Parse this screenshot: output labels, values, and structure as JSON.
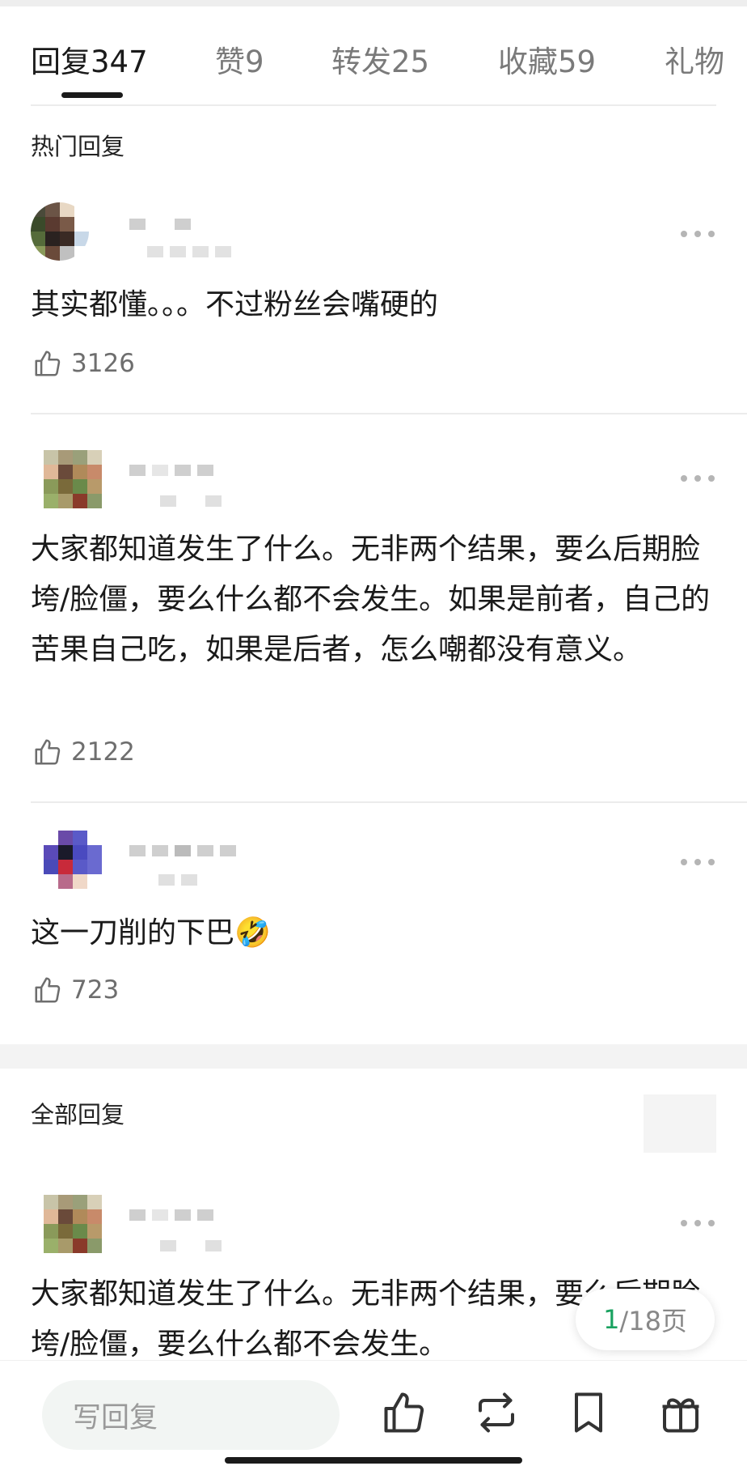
{
  "tabs": [
    {
      "label": "回复",
      "count": "347"
    },
    {
      "label": "赞",
      "count": "9"
    },
    {
      "label": "转发",
      "count": "25"
    },
    {
      "label": "收藏",
      "count": "59"
    },
    {
      "label": "礼物",
      "count": ""
    }
  ],
  "hot_section": {
    "title": "热门回复"
  },
  "all_section": {
    "title": "全部回复"
  },
  "comments": [
    {
      "text": "其实都懂。。。不过粉丝会嘴硬的",
      "likes": "3126"
    },
    {
      "text": "大家都知道发生了什么。无非两个结果，要么后期脸垮/脸僵，要么什么都不会发生。如果是前者，自己的苦果自己吃，如果是后者，怎么嘲都没有意义。",
      "likes": "2122"
    },
    {
      "text": "这一刀削的下巴",
      "emoji": "🤣",
      "likes": "723"
    },
    {
      "text": "大家都知道发生了什么。无非两个结果，要么后期脸垮/脸僵，要么什么都不会发生。"
    }
  ],
  "pager": {
    "current": "1",
    "total_label": "/18页"
  },
  "bottom_bar": {
    "reply_placeholder": "写回复"
  },
  "icons": {
    "like": "thumb-up-icon",
    "more": "more-dots-icon",
    "repost": "repost-icon",
    "favorite": "bookmark-icon",
    "gift": "gift-icon"
  },
  "colors": {
    "accent_green": "#1aa260",
    "text_muted": "#6e6e6e"
  }
}
